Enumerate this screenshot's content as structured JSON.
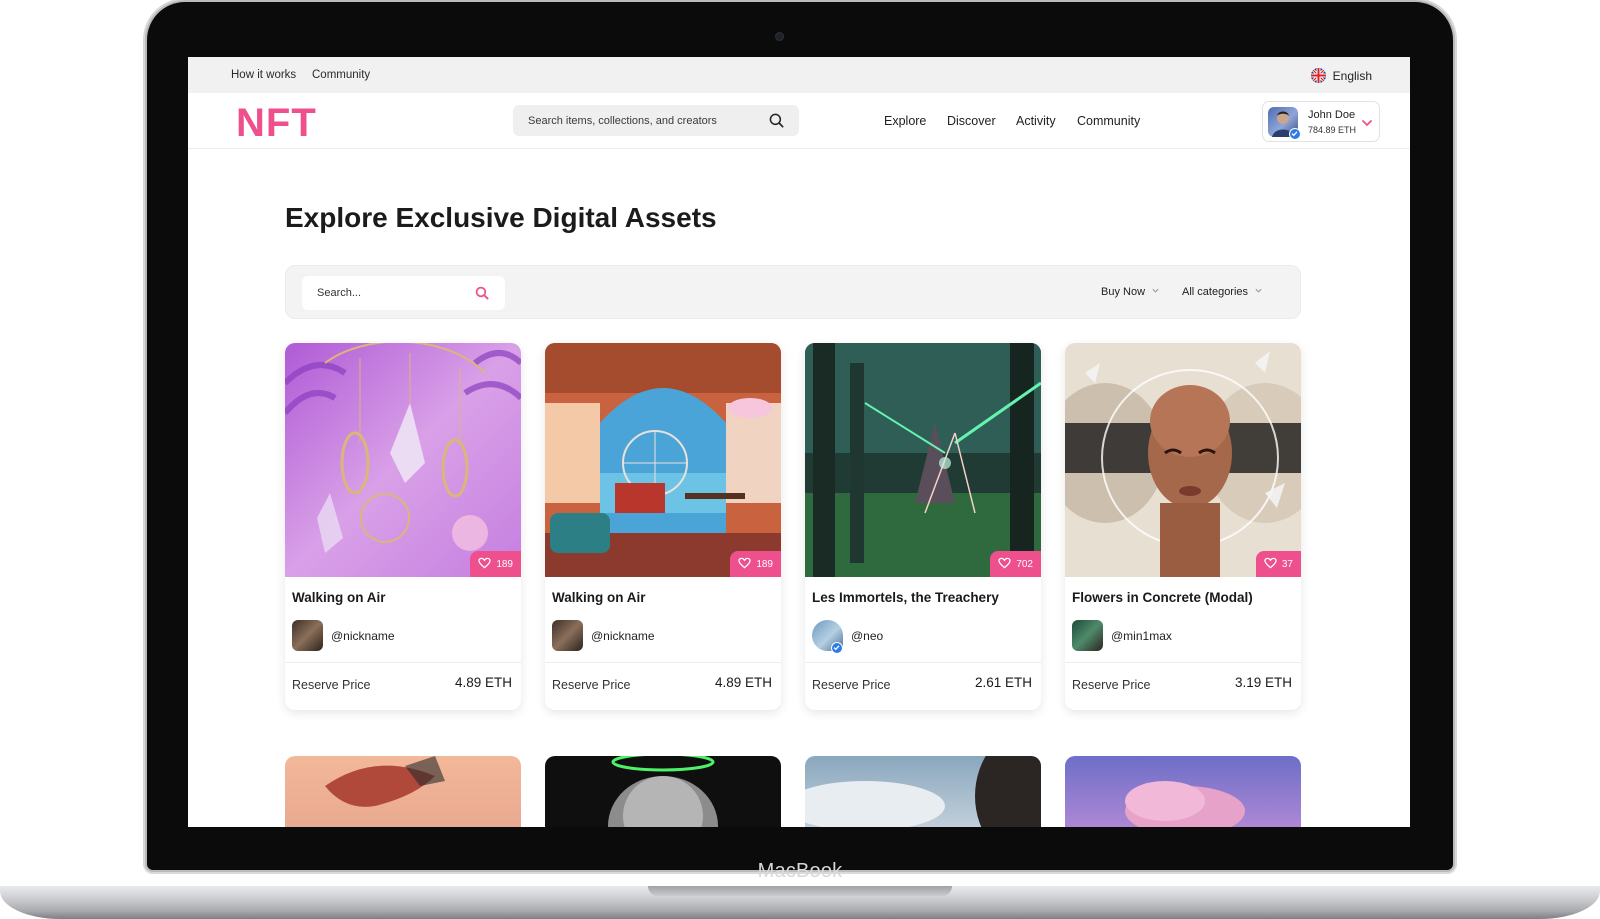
{
  "device": {
    "label": "MacBook"
  },
  "topbar": {
    "links": [
      "How it works",
      "Community"
    ],
    "language": "English"
  },
  "header": {
    "logo": "NFT",
    "search_placeholder": "Search items, collections, and creators",
    "nav": [
      "Explore",
      "Discover",
      "Activity",
      "Community"
    ],
    "user": {
      "name": "John Doe",
      "balance": "784.89 ETH"
    }
  },
  "main": {
    "title": "Explore Exclusive Digital Assets",
    "filter": {
      "search_placeholder": "Search...",
      "sale_type": "Buy Now",
      "category": "All categories"
    },
    "cards": [
      {
        "title": "Walking on Air",
        "creator": "@nickname",
        "likes": "189",
        "reserve_label": "Reserve Price",
        "price": "4.89 ETH"
      },
      {
        "title": "Walking on Air",
        "creator": "@nickname",
        "likes": "189",
        "reserve_label": "Reserve Price",
        "price": "4.89 ETH"
      },
      {
        "title": "Les Immortels, the Treachery",
        "creator": "@neo",
        "likes": "702",
        "reserve_label": "Reserve Price",
        "price": "2.61 ETH"
      },
      {
        "title": "Flowers in Concrete (Modal)",
        "creator": "@min1max",
        "likes": "37",
        "reserve_label": "Reserve Price",
        "price": "3.19 ETH"
      }
    ]
  },
  "colors": {
    "accent": "#ee4f8d",
    "verified": "#2f7be5"
  }
}
